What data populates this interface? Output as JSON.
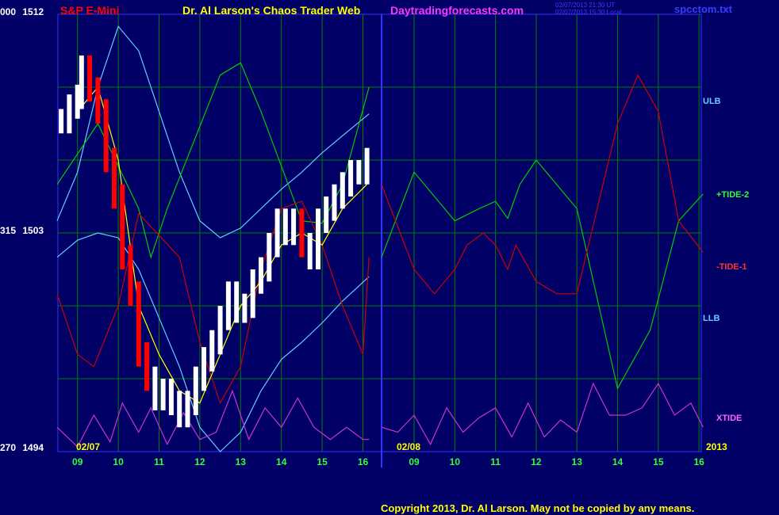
{
  "header": {
    "symbol": "S&P E-Mini",
    "title": "Dr. Al Larson's Chaos Trader Web",
    "site": "Daytradingforecasts.com",
    "time_ut": "02/07/2013 21:30 UT",
    "time_local": "02/07/2013 15:30 Local",
    "file": "spcctom.txt"
  },
  "footer": {
    "copyright": "Copyright 2013, Dr. Al Larson. May not be copied by any means."
  },
  "y_axis": {
    "labels": [
      {
        "angle": "000",
        "price": "1512"
      },
      {
        "angle": "315",
        "price": "1503"
      },
      {
        "angle": "270",
        "price": "1494"
      }
    ]
  },
  "x_axis": {
    "day1": "02/07",
    "day2": "02/08",
    "year": "2013",
    "hours_day1": [
      "09",
      "10",
      "11",
      "12",
      "13",
      "14",
      "15",
      "16"
    ],
    "hours_day2": [
      "09",
      "10",
      "11",
      "12",
      "13",
      "14",
      "15",
      "16"
    ]
  },
  "right_labels": {
    "ulb": "ULB",
    "tide2": "+TIDE-2",
    "tide1": "-TIDE-1",
    "llb": "LLB",
    "xtide": "XTIDE"
  },
  "colors": {
    "background": "#000066",
    "grid": "#008000",
    "divider": "#3333ff",
    "price": "#ffffff",
    "price_down": "#ff0000",
    "bands": "#66ccff",
    "tide2": "#00cc00",
    "tide1": "#cc0000",
    "xtide": "#cc33cc",
    "average": "#ffff00"
  },
  "chart_data": {
    "type": "line",
    "title": "S&P E-Mini",
    "ylim": [
      1494,
      1512
    ],
    "xlim_hours": [
      8.5,
      32.1
    ],
    "x_note": "hours; day 02/07 = 8.5-16.15, day 02/08 = 24+ hours",
    "series": [
      {
        "name": "Price",
        "color": "#ffffff",
        "x": [
          8.6,
          8.8,
          9.0,
          9.1,
          9.3,
          9.5,
          9.7,
          9.9,
          10.1,
          10.3,
          10.5,
          10.7,
          10.9,
          11.1,
          11.3,
          11.5,
          11.7,
          11.9,
          12.1,
          12.3,
          12.5,
          12.7,
          12.9,
          13.1,
          13.3,
          13.5,
          13.7,
          13.9,
          14.1,
          14.3,
          14.5,
          14.7,
          14.9,
          15.1,
          15.3,
          15.5,
          15.7,
          15.9,
          16.1
        ],
        "values": [
          1507.6,
          1508.2,
          1508.6,
          1509.8,
          1508.9,
          1508.0,
          1506.0,
          1504.5,
          1502.0,
          1500.5,
          1498.0,
          1497.0,
          1496.2,
          1496.5,
          1496.0,
          1495.5,
          1496.0,
          1497.0,
          1497.8,
          1498.5,
          1499.5,
          1500.5,
          1499.8,
          1500.0,
          1501.0,
          1501.5,
          1502.5,
          1503.5,
          1503.0,
          1503.5,
          1502.5,
          1502.0,
          1503.5,
          1504.0,
          1504.5,
          1505.0,
          1505.5,
          1505.5,
          1506.0
        ]
      },
      {
        "name": "ULB",
        "color": "#66ccff",
        "x": [
          8.5,
          9.0,
          9.5,
          10.0,
          10.5,
          11.0,
          11.5,
          12.0,
          12.5,
          13.0,
          13.5,
          14.0,
          14.5,
          15.0,
          15.5,
          16.15
        ],
        "values": [
          1503.5,
          1505.5,
          1509.0,
          1511.5,
          1510.5,
          1508.0,
          1505.5,
          1503.5,
          1502.8,
          1503.2,
          1504.0,
          1504.8,
          1505.5,
          1506.3,
          1507.0,
          1507.9
        ]
      },
      {
        "name": "LLB",
        "color": "#66ccff",
        "x": [
          8.5,
          9.0,
          9.5,
          10.0,
          10.5,
          11.0,
          11.5,
          12.0,
          12.5,
          13.0,
          13.5,
          14.0,
          14.5,
          15.0,
          15.5,
          16.15
        ],
        "values": [
          1502.0,
          1502.7,
          1503.0,
          1502.8,
          1501.5,
          1499.5,
          1497.5,
          1495.0,
          1494.0,
          1494.8,
          1496.5,
          1497.8,
          1498.5,
          1499.3,
          1500.2,
          1501.2
        ]
      },
      {
        "name": "+TIDE-2",
        "color": "#00cc00",
        "x": [
          8.5,
          9.5,
          10.5,
          10.8,
          11.2,
          12.5,
          13.0,
          13.5,
          14.5,
          15.0,
          15.5,
          16.15,
          24.2,
          25.0,
          26.0,
          26.6,
          27.0,
          27.3,
          27.6,
          28.0,
          29.0,
          30.0,
          30.8,
          31.5,
          32.1
        ],
        "values": [
          1505,
          1507.5,
          1504,
          1502,
          1504,
          1509.5,
          1510,
          1508,
          1503.5,
          1503.4,
          1505,
          1509,
          1502,
          1505.5,
          1503.5,
          1504,
          1504.3,
          1503.6,
          1505,
          1506,
          1504,
          1496.6,
          1499,
          1503.5,
          1504.6
        ]
      },
      {
        "name": "-TIDE-1",
        "color": "#cc0000",
        "x": [
          8.5,
          9.0,
          9.4,
          10.0,
          10.5,
          11.5,
          12.0,
          12.5,
          13.0,
          13.5,
          14.0,
          14.5,
          15.0,
          15.5,
          16.0,
          16.15,
          24.2,
          25.0,
          25.5,
          26.0,
          26.3,
          26.7,
          27.0,
          27.3,
          27.5,
          28.0,
          28.5,
          29.0,
          30.0,
          30.5,
          31.0,
          31.5,
          32.1
        ],
        "values": [
          1500.5,
          1498,
          1497.5,
          1500,
          1503.8,
          1502,
          1498.5,
          1496,
          1497.5,
          1501.5,
          1504,
          1504.3,
          1502.5,
          1500,
          1498,
          1502,
          1505,
          1501.5,
          1500.5,
          1501.5,
          1502.5,
          1503,
          1502.5,
          1501.5,
          1502.5,
          1501,
          1500.5,
          1500.5,
          1507.5,
          1509.5,
          1508,
          1503.5,
          1502.2
        ]
      },
      {
        "name": "XTIDE",
        "color": "#cc33cc",
        "x": [
          8.5,
          9.0,
          9.4,
          9.8,
          10.1,
          10.5,
          10.8,
          11.2,
          11.6,
          12.0,
          12.4,
          12.8,
          13.2,
          13.6,
          14.0,
          14.4,
          14.8,
          15.2,
          15.6,
          16.0,
          16.15,
          24.2,
          24.6,
          25.0,
          25.4,
          25.8,
          26.2,
          26.6,
          27.0,
          27.4,
          27.8,
          28.2,
          28.6,
          29.0,
          29.4,
          29.8,
          30.2,
          30.6,
          31.0,
          31.4,
          31.8,
          32.1
        ],
        "values": [
          1495,
          1494.2,
          1495.5,
          1494.4,
          1496,
          1494.8,
          1495.8,
          1494.3,
          1495.6,
          1494.5,
          1494.8,
          1496.5,
          1494.5,
          1495.8,
          1495,
          1496.2,
          1495,
          1494.5,
          1495,
          1494.5,
          1494.5,
          1495,
          1494.8,
          1495.5,
          1494.3,
          1495.8,
          1494.8,
          1495.4,
          1495.8,
          1494.6,
          1496,
          1494.6,
          1495.3,
          1494.8,
          1496.8,
          1495.5,
          1495.5,
          1495.8,
          1496.8,
          1495.5,
          1496,
          1495
        ]
      },
      {
        "name": "Average",
        "color": "#ffff00",
        "x": [
          9.0,
          9.5,
          10.0,
          10.5,
          11.0,
          11.5,
          12.0,
          12.5,
          13.0,
          13.5,
          14.0,
          14.5,
          15.0,
          15.5,
          16.1
        ],
        "values": [
          1508,
          1509,
          1506,
          1500,
          1498,
          1496.5,
          1496,
          1498,
          1500,
          1501,
          1502.5,
          1503,
          1502.5,
          1504,
          1505
        ]
      }
    ]
  }
}
